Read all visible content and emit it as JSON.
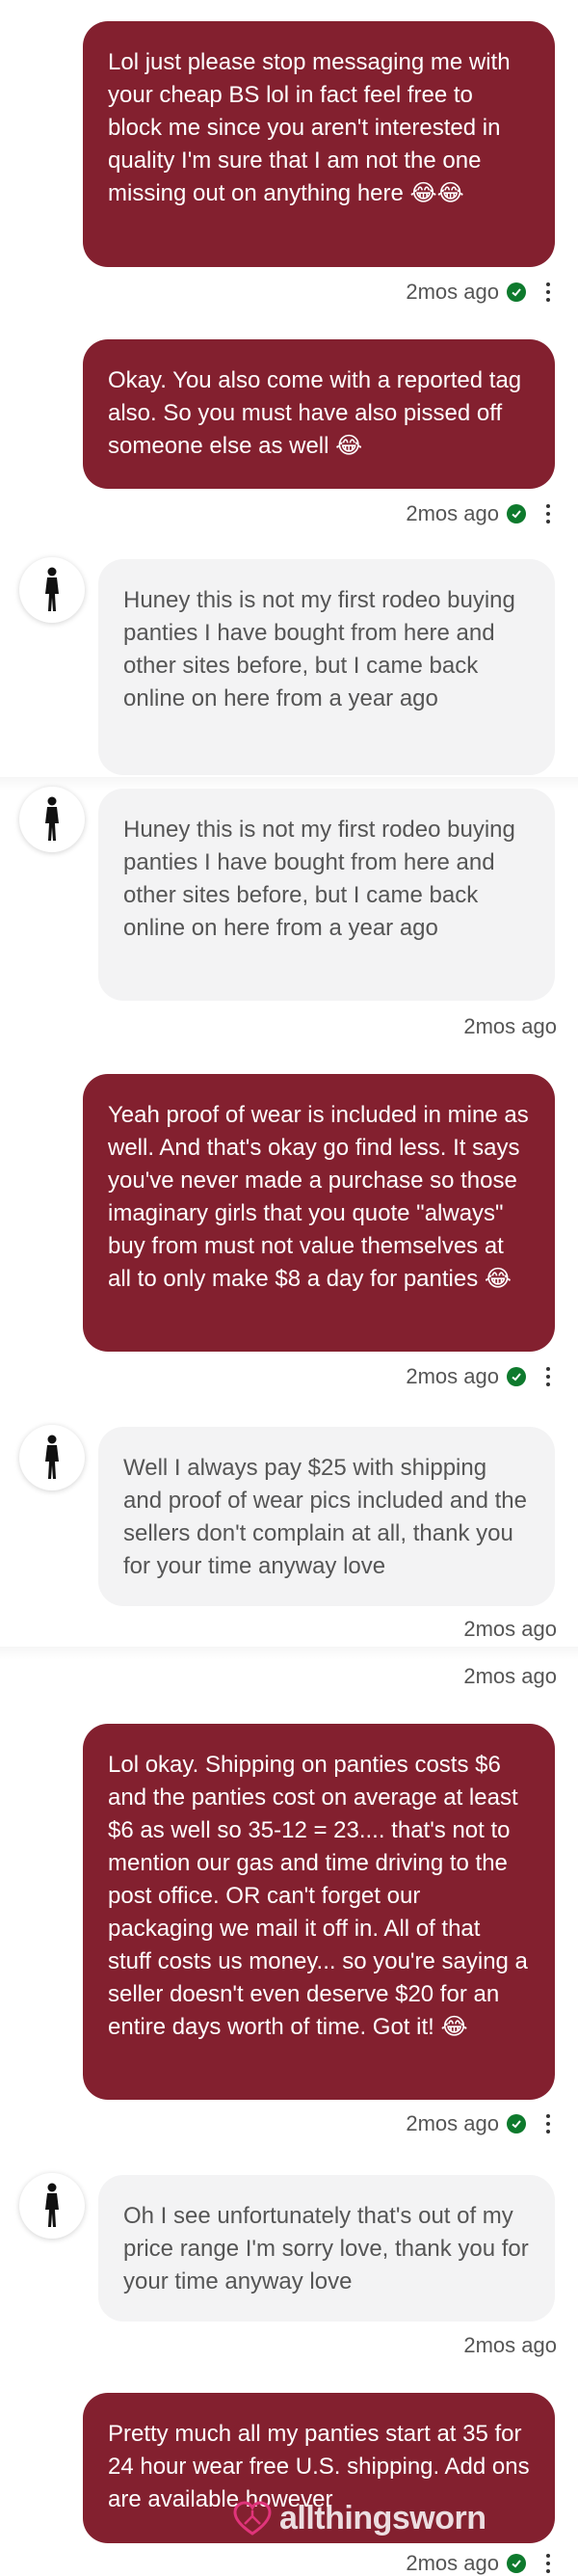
{
  "messages": [
    {
      "type": "sent",
      "text": "Lol just please stop messaging me with your cheap BS lol in fact feel free to block me since you aren't interested in quality I'm sure that I am not the one missing out on anything here 😂😂",
      "time": "2mos ago"
    },
    {
      "type": "sent",
      "text": "Okay. You also come with a reported tag also. So you must have also pissed off someone else as well 😂",
      "time": "2mos ago"
    },
    {
      "type": "recv",
      "text": "Huney this is not my first rodeo buying panties I have bought from here and other sites before, but I came back online on here from a year ago"
    },
    {
      "type": "recv",
      "text": "Huney this is not my first rodeo buying panties I have bought from here and other sites before, but I came back online on here from a year ago",
      "time": "2mos ago"
    },
    {
      "type": "sent",
      "text": "Yeah proof of wear is included in mine as well. And that's okay go find less. It says you've never made a purchase so those imaginary girls that you quote \"always\" buy from must not value themselves at all to only make $8 a day for panties 😂",
      "time": "2mos ago"
    },
    {
      "type": "recv",
      "text": "Well I always pay $25 with shipping and proof of wear pics included and the sellers don't complain at all, thank you for your time anyway love",
      "time": "2mos ago"
    },
    {
      "type": "time-only",
      "time": "2mos ago"
    },
    {
      "type": "sent",
      "text": "Lol okay. Shipping on panties costs $6 and the panties cost on average at least $6 as well so 35-12 = 23.... that's not to mention our gas and time driving to the post office. OR can't forget our packaging we mail it off in. All of that stuff costs us money... so you're saying a seller doesn't even deserve $20 for an entire days worth of time. Got it! 😂",
      "time": "2mos ago"
    },
    {
      "type": "recv",
      "text": "Oh I see unfortunately that's out of my price range I'm sorry love, thank you for your time anyway love",
      "time": "2mos ago"
    },
    {
      "type": "sent",
      "text": "Pretty much all my panties start at 35 for 24 hour wear free U.S. shipping. Add ons are available however",
      "time": "2mos ago"
    }
  ],
  "watermark": {
    "text": "allthingsworn",
    "icon": "heart-hanger-logo"
  },
  "colors": {
    "sent_bubble": "#83202f",
    "recv_bubble": "#f3f3f4",
    "read_check": "#0e7a2d"
  }
}
